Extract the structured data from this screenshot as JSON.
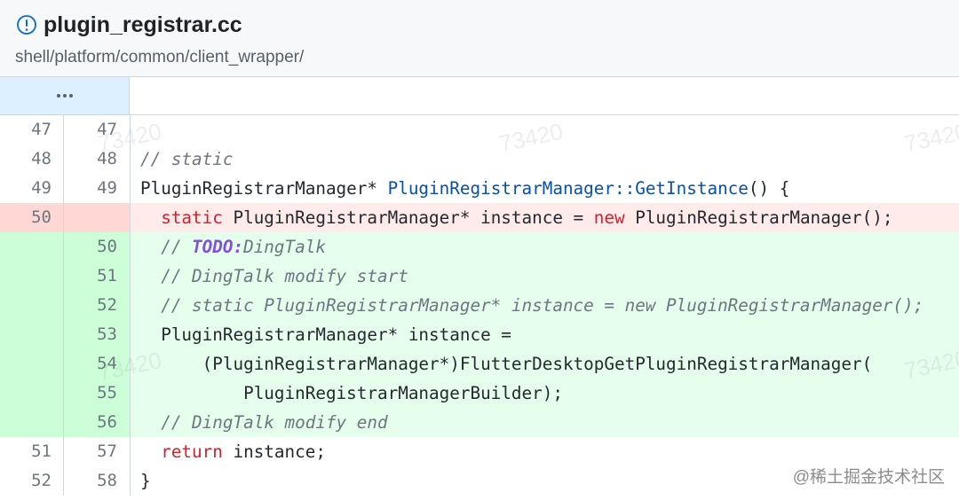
{
  "file": {
    "name": "plugin_registrar.cc",
    "path": "shell/platform/common/client_wrapper/",
    "icon": "info-circle-icon"
  },
  "hunk": {
    "expand_icon": "ellipsis-icon"
  },
  "lines": [
    {
      "old": "47",
      "new": "47",
      "type": "context",
      "tokens": []
    },
    {
      "old": "48",
      "new": "48",
      "type": "context",
      "tokens": [
        {
          "t": "// static",
          "c": "com"
        }
      ]
    },
    {
      "old": "49",
      "new": "49",
      "type": "context",
      "tokens": [
        {
          "t": "PluginRegistrarManager* ",
          "c": ""
        },
        {
          "t": "PluginRegistrarManager::GetInstance",
          "c": "fn"
        },
        {
          "t": "() {",
          "c": ""
        }
      ]
    },
    {
      "old": "50",
      "new": "",
      "type": "del",
      "tokens": [
        {
          "t": "  ",
          "c": ""
        },
        {
          "t": "static",
          "c": "kw"
        },
        {
          "t": " PluginRegistrarManager* instance = ",
          "c": ""
        },
        {
          "t": "new",
          "c": "kw"
        },
        {
          "t": " PluginRegistrarManager();",
          "c": ""
        }
      ]
    },
    {
      "old": "",
      "new": "50",
      "type": "add",
      "tokens": [
        {
          "t": "  // ",
          "c": "com"
        },
        {
          "t": "TODO:",
          "c": "todo"
        },
        {
          "t": "DingTalk",
          "c": "com"
        }
      ]
    },
    {
      "old": "",
      "new": "51",
      "type": "add",
      "tokens": [
        {
          "t": "  // DingTalk modify start",
          "c": "com"
        }
      ]
    },
    {
      "old": "",
      "new": "52",
      "type": "add",
      "tokens": [
        {
          "t": "  // static PluginRegistrarManager* instance = new PluginRegistrarManager();",
          "c": "com"
        }
      ]
    },
    {
      "old": "",
      "new": "53",
      "type": "add",
      "tokens": [
        {
          "t": "  PluginRegistrarManager* instance =",
          "c": ""
        }
      ]
    },
    {
      "old": "",
      "new": "54",
      "type": "add",
      "tokens": [
        {
          "t": "      (PluginRegistrarManager*)FlutterDesktopGetPluginRegistrarManager(",
          "c": ""
        }
      ]
    },
    {
      "old": "",
      "new": "55",
      "type": "add",
      "tokens": [
        {
          "t": "          PluginRegistrarManagerBuilder);",
          "c": ""
        }
      ]
    },
    {
      "old": "",
      "new": "56",
      "type": "add",
      "tokens": [
        {
          "t": "  // DingTalk modify end",
          "c": "com"
        }
      ]
    },
    {
      "old": "51",
      "new": "57",
      "type": "context",
      "tokens": [
        {
          "t": "  ",
          "c": ""
        },
        {
          "t": "return",
          "c": "kw"
        },
        {
          "t": " instance;",
          "c": ""
        }
      ]
    },
    {
      "old": "52",
      "new": "58",
      "type": "context",
      "tokens": [
        {
          "t": "}",
          "c": ""
        }
      ]
    }
  ],
  "watermark_text": "73420",
  "site_watermark": "@稀土掘金技术社区",
  "colors": {
    "deleted_bg": "#ffebe9",
    "added_bg": "#e6ffec",
    "hunk_bg": "#ddf0ff",
    "keyword": "#cf222e",
    "function": "#0550ae",
    "todo": "#8250df"
  }
}
